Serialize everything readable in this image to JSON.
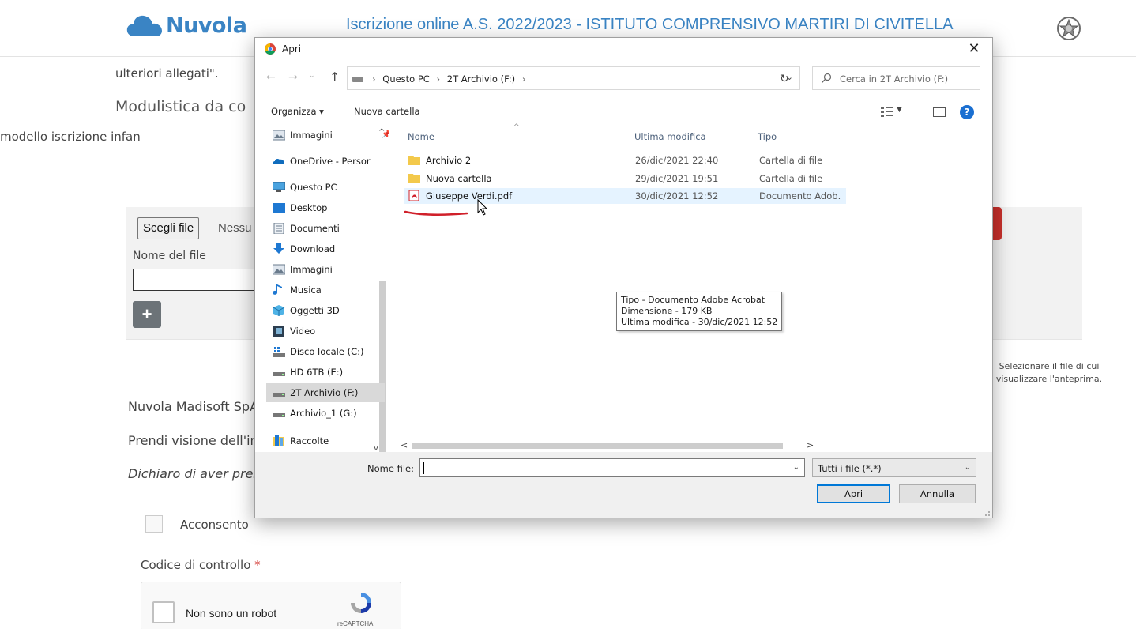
{
  "page": {
    "logo_text": "Nuvola",
    "header_title": "Iscrizione online A.S. 2022/2023 - ISTITUTO COMPRENSIVO MARTIRI DI CIVITELLA",
    "ulteriori": "ulteriori allegati\".",
    "modulistica": "Modulistica da co",
    "modello": "modello iscrizione infan",
    "choose_file": "Scegli file",
    "no_file": "Nessu",
    "nome_del_file": "Nome del file",
    "plus": "+",
    "madisoft": "Nuvola Madisoft SpA",
    "prendi": "Prendi visione dell'in",
    "dichiaro": "Dichiaro di aver pres",
    "acconsento": "Acconsento",
    "codice": "Codice di controllo",
    "required_mark": "*",
    "recaptcha_label": "Non sono un robot",
    "recaptcha_brand": "reCAPTCHA"
  },
  "dialog": {
    "title": "Apri",
    "close": "✕",
    "nav": {
      "back": "←",
      "forward": "→",
      "recent": "⌄",
      "up": "↑"
    },
    "address": {
      "parts": [
        "Questo PC",
        "2T Archivio (F:)"
      ],
      "sep": "›",
      "lead": "›",
      "tail": "›",
      "drop": "⌄"
    },
    "refresh": "↻",
    "search_placeholder": "Cerca in 2T Archivio (F:)",
    "organizza": "Organizza ▾",
    "nuova_cartella": "Nuova cartella",
    "view_drop": "▼",
    "help": "?",
    "nav_items": [
      {
        "label": "Immagini",
        "icon": "pictures-icon"
      },
      {
        "label": "OneDrive - Persor",
        "icon": "onedrive-icon"
      },
      {
        "label": "Questo PC",
        "icon": "computer-icon"
      },
      {
        "label": "Desktop",
        "icon": "desktop-icon"
      },
      {
        "label": "Documenti",
        "icon": "documents-icon"
      },
      {
        "label": "Download",
        "icon": "download-icon"
      },
      {
        "label": "Immagini",
        "icon": "pictures-icon"
      },
      {
        "label": "Musica",
        "icon": "music-icon"
      },
      {
        "label": "Oggetti 3D",
        "icon": "objects-3d-icon"
      },
      {
        "label": "Video",
        "icon": "video-icon"
      },
      {
        "label": "Disco locale (C:)",
        "icon": "windows-drive-icon"
      },
      {
        "label": "HD 6TB (E:)",
        "icon": "drive-icon"
      },
      {
        "label": "2T Archivio (F:)",
        "icon": "drive-icon"
      },
      {
        "label": "Archivio_1 (G:)",
        "icon": "drive-icon"
      },
      {
        "label": "Raccolte",
        "icon": "libraries-icon"
      }
    ],
    "columns": {
      "name": "Nome",
      "modified": "Ultima modifica",
      "type": "Tipo"
    },
    "files": [
      {
        "name": "Archivio 2",
        "modified": "26/dic/2021 22:40",
        "type": "Cartella di file",
        "icon": "folder-icon"
      },
      {
        "name": "Nuova cartella",
        "modified": "29/dic/2021 19:51",
        "type": "Cartella di file",
        "icon": "folder-icon"
      },
      {
        "name": "Giuseppe Verdi.pdf",
        "modified": "30/dic/2021 12:52",
        "type": "Documento Adob.",
        "icon": "pdf-icon"
      }
    ],
    "tooltip": {
      "line1": "Tipo - Documento Adobe Acrobat",
      "line2": "Dimensione - 179 KB",
      "line3": "Ultima modifica - 30/dic/2021 12:52"
    },
    "preview_text": "Selezionare il file di cui visualizzare l'anteprima.",
    "scroll": {
      "left": "<",
      "right": ">",
      "up": "^",
      "down": "v",
      "pin": "📌"
    },
    "filename_label": "Nome file:",
    "filename_value": "",
    "filter": "Tutti i file (*.*)",
    "open_button": "Apri",
    "cancel_button": "Annulla",
    "drop": "⌄"
  },
  "colors": {
    "brand": "#3a84c4",
    "accent": "#0078d7",
    "selection": "#e5f3ff",
    "annotation": "#d0202a"
  }
}
